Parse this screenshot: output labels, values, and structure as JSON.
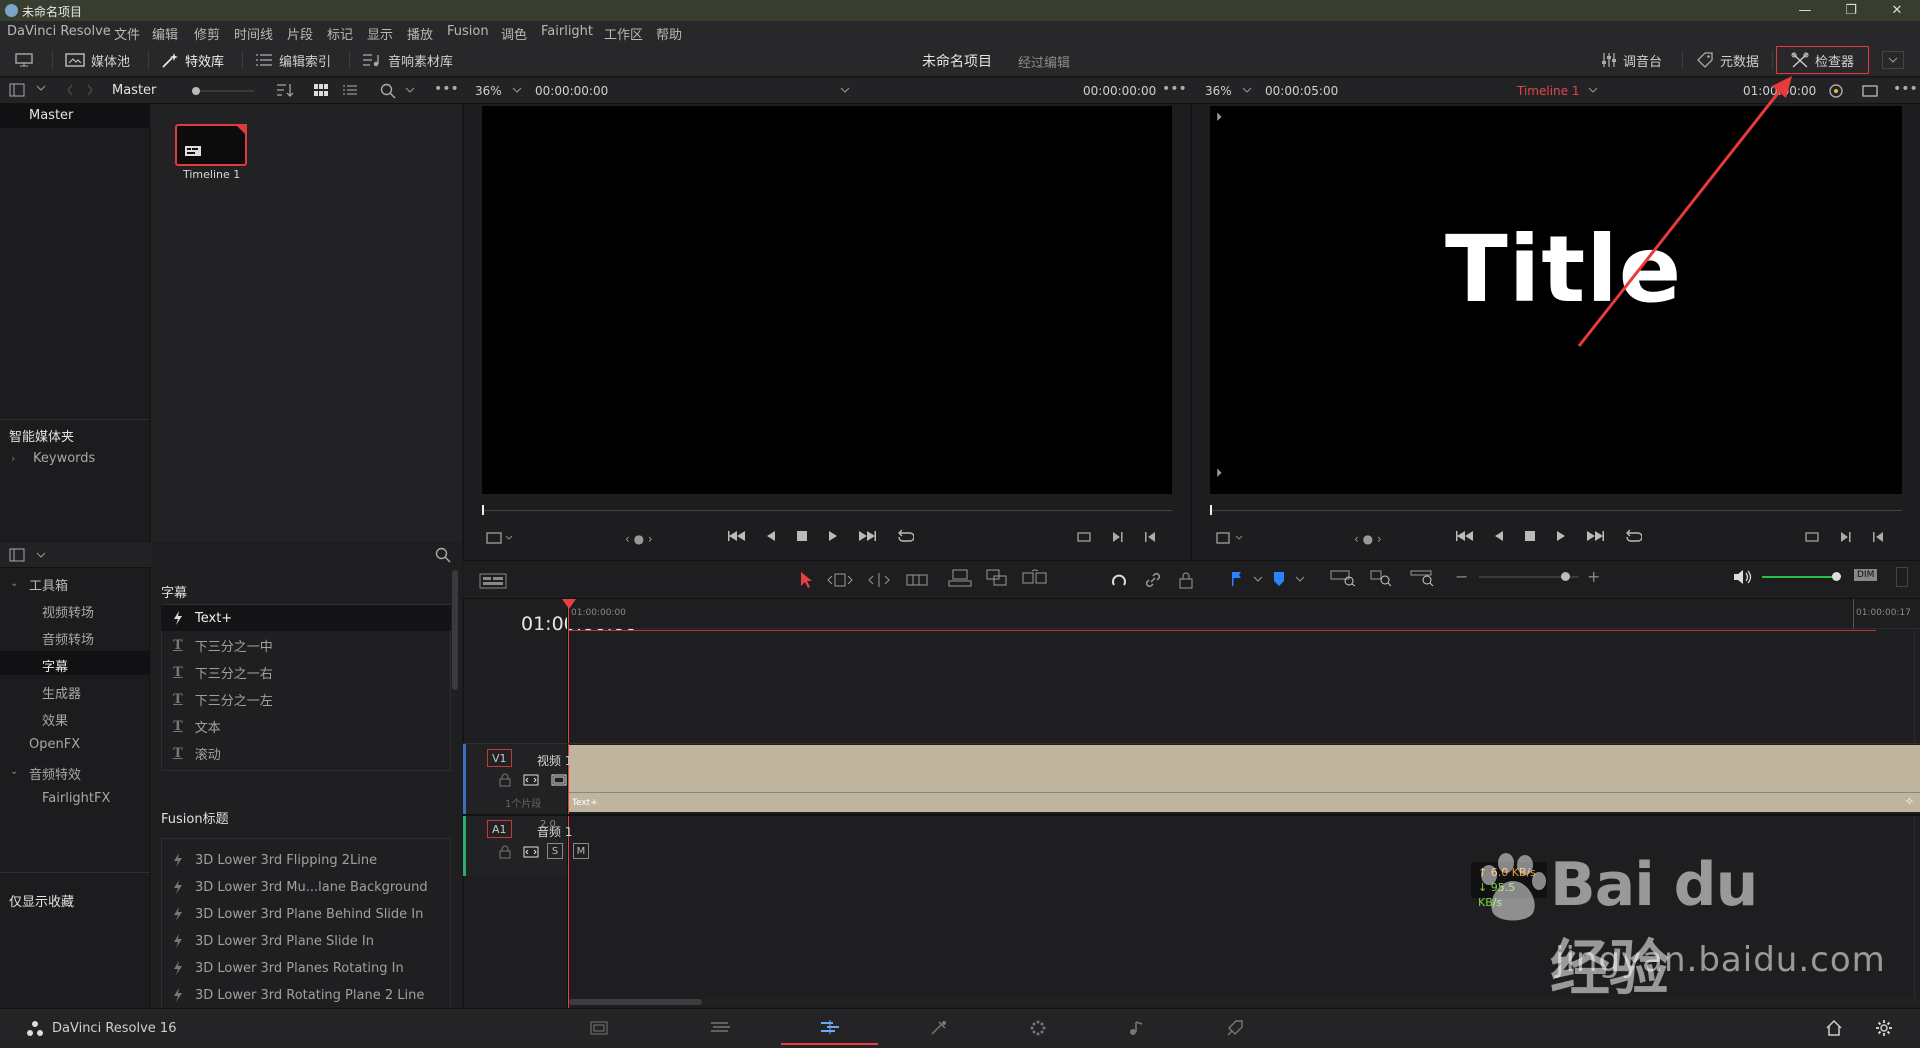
{
  "window": {
    "title": "未命名项目",
    "controls": [
      "—",
      "❐",
      "✕"
    ]
  },
  "menu": [
    "DaVinci Resolve",
    "文件",
    "编辑",
    "修剪",
    "时间线",
    "片段",
    "标记",
    "显示",
    "播放",
    "Fusion",
    "调色",
    "Fairlight",
    "工作区",
    "帮助"
  ],
  "toolbar": {
    "media_pool": "媒体池",
    "effects_library": "特效库",
    "edit_index": "编辑索引",
    "sound_library": "音响素材库",
    "project_name": "未命名项目",
    "project_status": "经过编辑",
    "mixer": "调音台",
    "metadata": "元数据",
    "inspector": "检查器"
  },
  "subbar": {
    "bin_name": "Master",
    "src_zoom": "36%",
    "src_timecode_in": "00:00:00:00",
    "src_timecode_out": "00:00:00:00",
    "tl_zoom": "36%",
    "tl_duration": "00:00:05:00",
    "timeline_name": "Timeline 1",
    "tl_timecode": "01:00:00:00"
  },
  "bins": {
    "master": "Master",
    "smart_bins": "智能媒体夹",
    "keywords": "Keywords",
    "favorites": "仅显示收藏"
  },
  "clips": [
    {
      "name": "Timeline 1"
    }
  ],
  "fx_tree": {
    "toolbox": "工具箱",
    "items": [
      "视频转场",
      "音频转场",
      "字幕",
      "生成器",
      "效果"
    ],
    "openfx": "OpenFX",
    "audio_fx": "音频特效",
    "fairlight_fx": "FairlightFX",
    "selected": "字幕"
  },
  "fx_list": {
    "titles_header": "字幕",
    "titles": [
      "Text+",
      "下三分之一中",
      "下三分之一右",
      "下三分之一左",
      "文本",
      "滚动"
    ],
    "fusion_header": "Fusion标题",
    "fusion_titles": [
      "3D Lower 3rd Flipping 2Line",
      "3D Lower 3rd Mu...lane Background",
      "3D Lower 3rd Plane Behind Slide In",
      "3D Lower 3rd Plane Slide In",
      "3D Lower 3rd Planes Rotating In",
      "3D Lower 3rd Rotating Plane 2 Line"
    ]
  },
  "viewer": {
    "title_text": "Title"
  },
  "timeline": {
    "current_timecode": "01:00:00:00",
    "ruler_start": "01:00:00:00",
    "ruler_end": "01:00:00:17",
    "video_track": {
      "id": "V1",
      "name": "视频 1",
      "clips_count": "1个片段",
      "clip_name": "Text+"
    },
    "audio_track": {
      "id": "A1",
      "name": "音频 1",
      "channels": "2.0",
      "solo": "S",
      "mute": "M"
    },
    "net_up": "↑ 6.0 KB/s",
    "net_down": "↓ 95.5 KB/s"
  },
  "bottom": {
    "app_name": "DaVinci Resolve 16"
  },
  "watermark": {
    "brand": "Bai du 经验",
    "url": "jingyan.baidu.com"
  },
  "colors": {
    "accent_red": "#e03b3b",
    "clip_beige": "#bfb59e",
    "playhead": "#e64040"
  }
}
